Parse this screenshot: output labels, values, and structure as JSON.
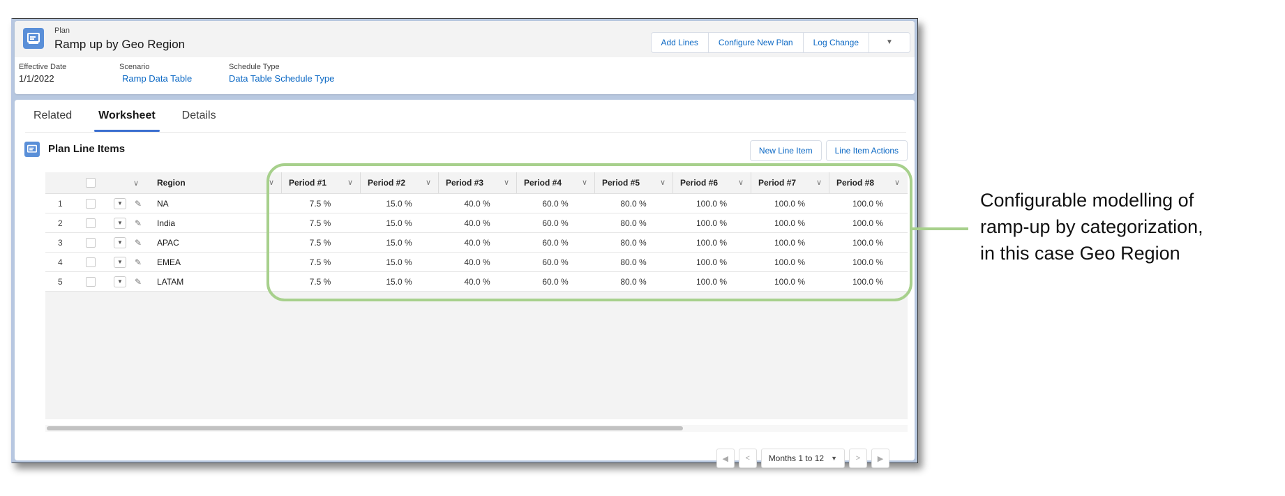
{
  "record": {
    "object_label": "Plan",
    "title": "Ramp up by Geo Region",
    "actions": [
      "Add Lines",
      "Configure New Plan",
      "Log Change"
    ],
    "fields": [
      {
        "label": "Effective Date",
        "value": "1/1/2022",
        "link": false
      },
      {
        "label": "Scenario",
        "value": "Ramp Data Table",
        "link": true
      },
      {
        "label": "Schedule Type",
        "value": "Data Table Schedule Type",
        "link": true
      }
    ]
  },
  "tabs": [
    {
      "label": "Related",
      "active": false
    },
    {
      "label": "Worksheet",
      "active": true
    },
    {
      "label": "Details",
      "active": false
    }
  ],
  "card": {
    "title": "Plan Line Items",
    "buttons": [
      "New Line Item",
      "Line Item Actions"
    ]
  },
  "grid": {
    "columns": [
      "Region",
      "Period #1",
      "Period #2",
      "Period #3",
      "Period #4",
      "Period #5",
      "Period #6",
      "Period #7",
      "Period #8"
    ],
    "rows": [
      {
        "num": "1",
        "region": "NA",
        "values": [
          "7.5 %",
          "15.0 %",
          "40.0 %",
          "60.0 %",
          "80.0 %",
          "100.0 %",
          "100.0 %",
          "100.0 %"
        ]
      },
      {
        "num": "2",
        "region": "India",
        "values": [
          "7.5 %",
          "15.0 %",
          "40.0 %",
          "60.0 %",
          "80.0 %",
          "100.0 %",
          "100.0 %",
          "100.0 %"
        ]
      },
      {
        "num": "3",
        "region": "APAC",
        "values": [
          "7.5 %",
          "15.0 %",
          "40.0 %",
          "60.0 %",
          "80.0 %",
          "100.0 %",
          "100.0 %",
          "100.0 %"
        ]
      },
      {
        "num": "4",
        "region": "EMEA",
        "values": [
          "7.5 %",
          "15.0 %",
          "40.0 %",
          "60.0 %",
          "80.0 %",
          "100.0 %",
          "100.0 %",
          "100.0 %"
        ]
      },
      {
        "num": "5",
        "region": "LATAM",
        "values": [
          "7.5 %",
          "15.0 %",
          "40.0 %",
          "60.0 %",
          "80.0 %",
          "100.0 %",
          "100.0 %",
          "100.0 %"
        ]
      }
    ]
  },
  "pager": {
    "range_label": "Months 1 to 12"
  },
  "callout": {
    "lines": [
      "Configurable modelling of",
      "ramp-up by categorization,",
      "in this case Geo Region"
    ],
    "color": "#a7d08c"
  },
  "colors": {
    "brand_icon": "#5a8fd8",
    "link": "#0b68c4",
    "active_tab": "#3b6fd0"
  }
}
